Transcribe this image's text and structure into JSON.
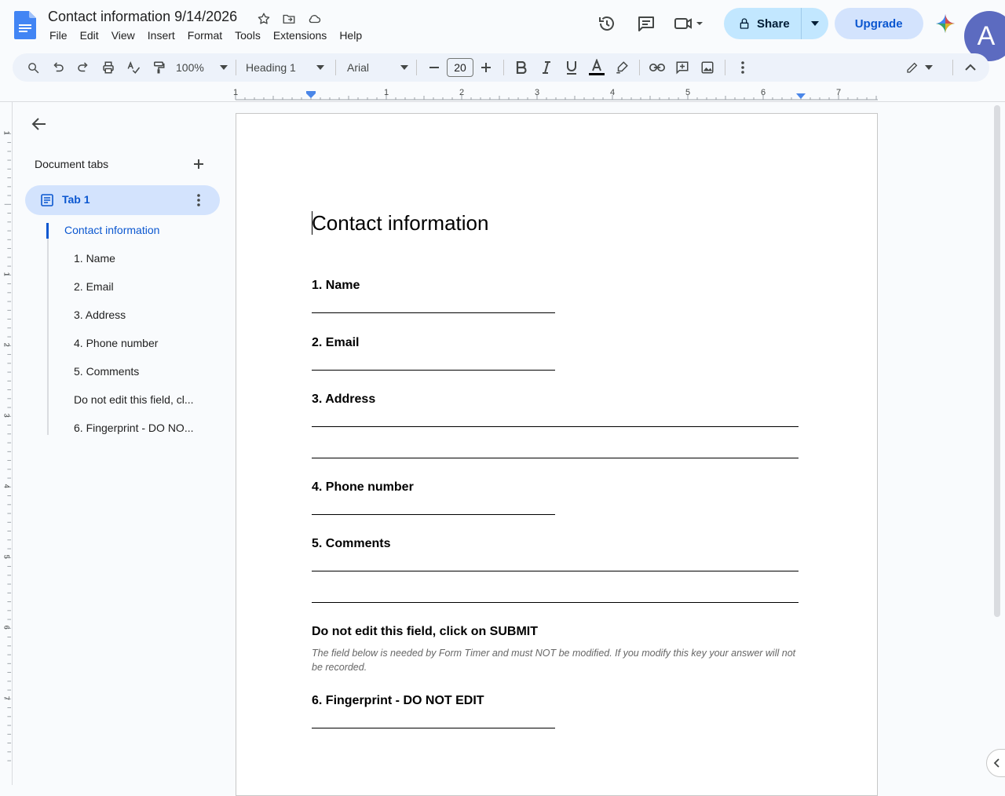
{
  "document": {
    "title": "Contact information 9/14/2026"
  },
  "menu": [
    "File",
    "Edit",
    "View",
    "Insert",
    "Format",
    "Tools",
    "Extensions",
    "Help"
  ],
  "header_actions": {
    "share_label": "Share",
    "upgrade_label": "Upgrade",
    "avatar_initial": "A"
  },
  "toolbar": {
    "zoom": "100%",
    "style": "Heading 1",
    "font": "Arial",
    "font_size": "20"
  },
  "ruler": {
    "labels": [
      "1",
      "1",
      "2",
      "3",
      "4",
      "5",
      "6",
      "7"
    ]
  },
  "vertical_ruler": {
    "labels": [
      "1",
      "1",
      "2",
      "3",
      "4",
      "5",
      "6",
      "7"
    ]
  },
  "sidebar": {
    "section_title": "Document tabs",
    "tab_label": "Tab 1",
    "outline": [
      "Contact information",
      "1. Name",
      "2. Email",
      "3. Address",
      "4. Phone number",
      "5. Comments",
      "Do not edit this field, cl...",
      "6. Fingerprint - DO NO..."
    ]
  },
  "page": {
    "heading": "Contact information",
    "questions": [
      "1. Name",
      "2. Email",
      "3. Address",
      "4. Phone number",
      "5. Comments",
      "Do not edit this field, click on SUBMIT",
      "6. Fingerprint - DO NOT EDIT"
    ],
    "note": "The field below is needed by Form Timer and must NOT be modified. If you modify this key your answer will not be recorded."
  },
  "colors": {
    "accent": "#0b57d0",
    "share_bg": "#c2e7ff",
    "toolbar_bg": "#edf2fa"
  }
}
